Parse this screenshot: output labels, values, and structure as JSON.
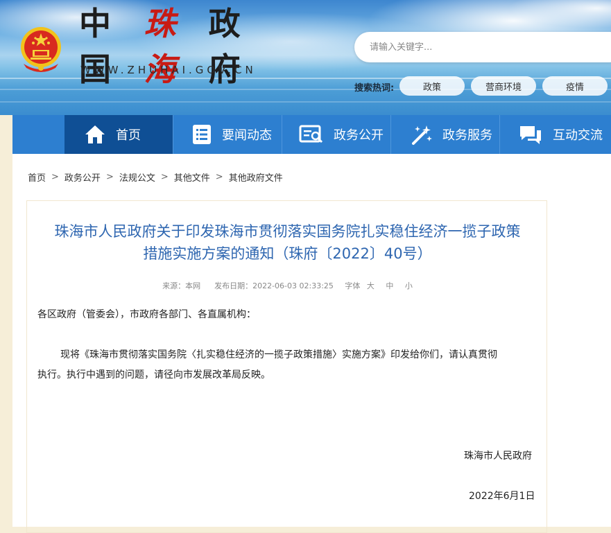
{
  "header": {
    "logo_cn_prefix": "中国",
    "logo_cn_city": "珠海",
    "logo_cn_suffix": "政府",
    "logo_en": "WWW.ZHUHAI.GOV.CN",
    "search_placeholder": "请输入关键字...",
    "hot_label": "搜索热词:",
    "hot_tags": [
      "政策",
      "营商环境",
      "疫情"
    ]
  },
  "nav": {
    "items": [
      {
        "label": "首页",
        "icon": "home-icon"
      },
      {
        "label": "要闻动态",
        "icon": "news-list-icon"
      },
      {
        "label": "政务公开",
        "icon": "document-search-icon"
      },
      {
        "label": "政务服务",
        "icon": "magic-wand-icon"
      },
      {
        "label": "互动交流",
        "icon": "chat-bubbles-icon"
      }
    ],
    "active_index": 0
  },
  "breadcrumb": [
    "首页",
    "政务公开",
    "法规公文",
    "其他文件",
    "其他政府文件"
  ],
  "breadcrumb_separator": ">",
  "article": {
    "title_line1": "珠海市人民政府关于印发珠海市贯彻落实国务院扎实稳住经济一揽子政策",
    "title_line2": "措施实施方案的通知（珠府〔2022〕40号）",
    "meta": {
      "source_label": "来源：",
      "source": "本网",
      "date_label": "发布日期：",
      "date": "2022-06-03 02:33:25",
      "font_label": "字体",
      "font_large": "大",
      "font_medium": "中",
      "font_small": "小"
    },
    "salutation": "各区政府（管委会），市政府各部门、各直属机构：",
    "paragraph_line1": "现将《珠海市贯彻落实国务院〈扎实稳住经济的一揽子政策措施〉实施方案》印发给你们，请认真贯彻",
    "paragraph_line2": "执行。执行中遇到的问题，请径向市发展改革局反映。",
    "signature": "珠海市人民政府",
    "signed_date": "2022年6月1日"
  },
  "colors": {
    "nav_bg": "#2d7fd0",
    "nav_active": "#0f4f95",
    "title": "#2e66b0",
    "logo_red": "#c81b14"
  }
}
